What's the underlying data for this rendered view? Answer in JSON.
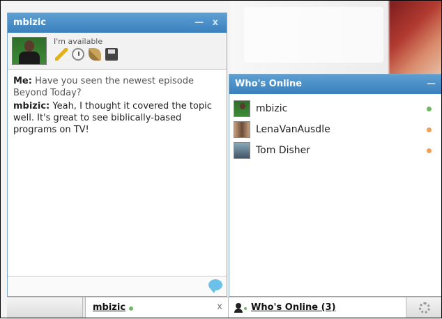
{
  "chat_window": {
    "title": "mbizic",
    "controls": "— x",
    "status_text": "I'm available",
    "messages": [
      {
        "sender": "Me:",
        "text": "Have you seen the newest episode Beyond Today?"
      },
      {
        "sender": "mbizic:",
        "text": "Yeah, I thought it covered the topic well. It's great to see biblically-based programs on TV!"
      }
    ],
    "icons": [
      "pencil-icon",
      "clock-icon",
      "broom-icon",
      "save-icon",
      "chat-bubble-icon"
    ]
  },
  "whos_online": {
    "title": "Who's Online",
    "controls": "—",
    "users": [
      {
        "name": "mbizic",
        "status": "green"
      },
      {
        "name": "LenaVanAusdle",
        "status": "orange"
      },
      {
        "name": "Tom Disher",
        "status": "orange"
      }
    ]
  },
  "taskbar": {
    "chat_tab_name": "mbizic",
    "chat_tab_close": "x",
    "whos_online_tab": "Who's Online (3)"
  },
  "colors": {
    "titlebar": "#3a80bd",
    "online": "#6dbb5f",
    "idle": "#f0a05a"
  }
}
